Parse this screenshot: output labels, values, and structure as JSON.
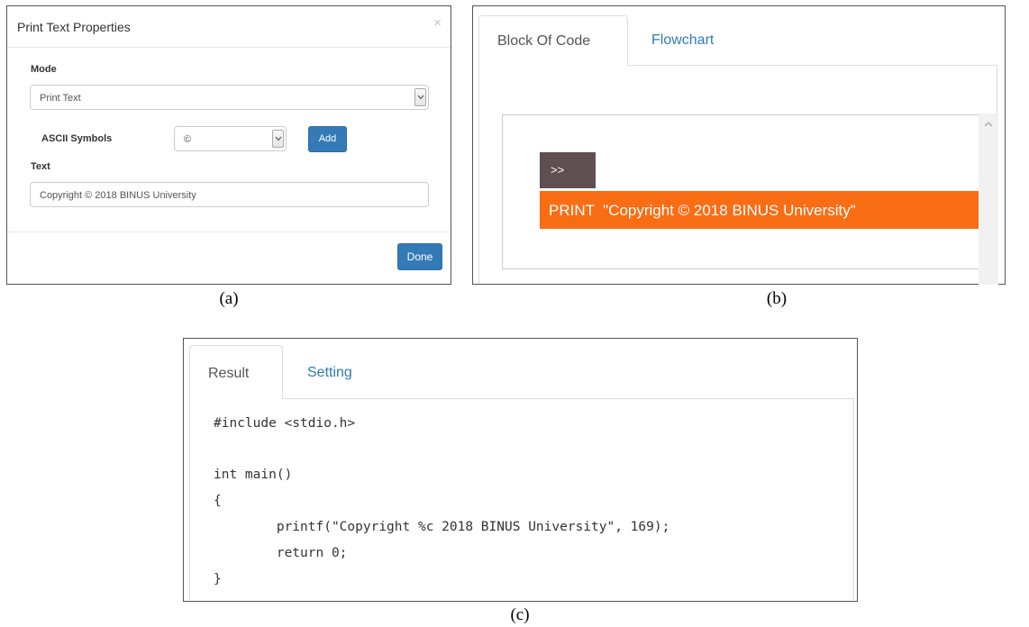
{
  "panel_a": {
    "title": "Print Text Properties",
    "close": "×",
    "mode_label": "Mode",
    "mode_value": "Print Text",
    "ascii_label": "ASCII Symbols",
    "ascii_value": "©",
    "add_label": "Add",
    "text_label": "Text",
    "text_value": "Copyright © 2018 BINUS University",
    "done_label": "Done",
    "caption": "(a)"
  },
  "panel_b": {
    "tabs": [
      "Block Of Code",
      "Flowchart"
    ],
    "run_label": ">>",
    "print_block": "PRINT  \"Copyright © 2018 BINUS University\"",
    "caption": "(b)",
    "colors": {
      "print_block": "#f96d15",
      "run_block": "#5f4f51"
    }
  },
  "panel_c": {
    "tabs": [
      "Result",
      "Setting"
    ],
    "code_lines": [
      "#include <stdio.h>",
      "",
      "int main()",
      "{",
      "        printf(\"Copyright %c 2018 BINUS University\", 169);",
      "        return 0;",
      "}"
    ],
    "caption": "(c)"
  },
  "colors": {
    "primary": "#337ab7",
    "link": "#337ab7"
  }
}
